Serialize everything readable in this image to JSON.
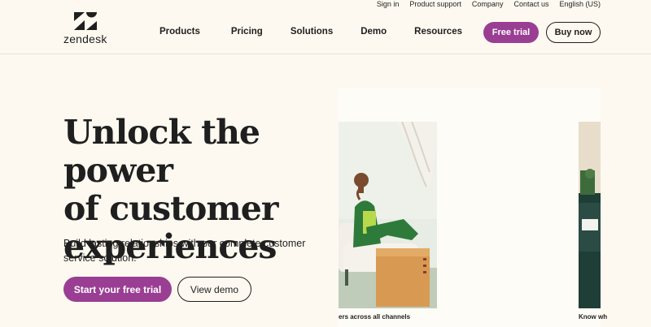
{
  "utility_nav": [
    "Sign in",
    "Product support",
    "Company",
    "Contact us",
    "English (US)"
  ],
  "brand": {
    "wordmark": "zendesk",
    "accent": "#9a3e93"
  },
  "nav": {
    "items": [
      "Products",
      "Pricing",
      "Solutions",
      "Demo",
      "Resources"
    ]
  },
  "header_buttons": {
    "trial": "Free trial",
    "buy": "Buy now"
  },
  "hero": {
    "title_line1": "Unlock the power",
    "title_line2": "of customer",
    "title_line3": "experiences",
    "subtitle_line1": "Build lasting relationships with our complete customer",
    "subtitle_line2": "service solution.",
    "cta_primary": "Start your free trial",
    "cta_secondary": "View demo"
  },
  "carousel": {
    "caption1": "ers across all channels",
    "caption2": "Know wh"
  }
}
